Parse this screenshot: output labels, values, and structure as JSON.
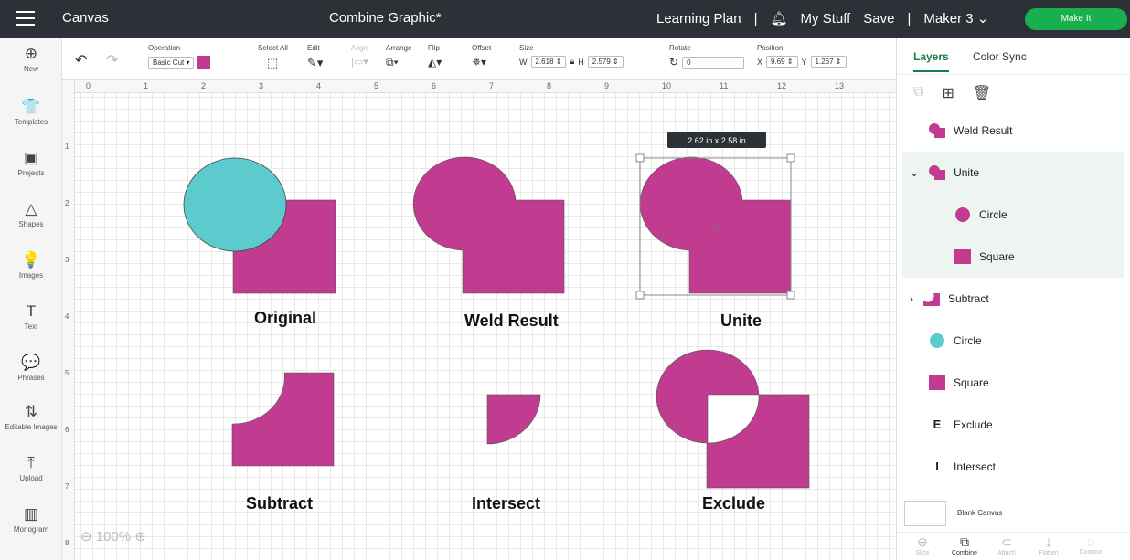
{
  "topbar": {
    "app_name": "Canvas",
    "doc_title": "Combine Graphic*",
    "learning_plan": "Learning Plan",
    "sep": "|",
    "my_stuff": "My Stuff",
    "save": "Save",
    "machine": "Maker 3",
    "make_it": "Make It"
  },
  "sidebar": {
    "items": [
      {
        "label": "New",
        "icon": "⊕"
      },
      {
        "label": "Templates",
        "icon": "👕"
      },
      {
        "label": "Projects",
        "icon": "▣"
      },
      {
        "label": "Shapes",
        "icon": "△"
      },
      {
        "label": "Images",
        "icon": "💡"
      },
      {
        "label": "Text",
        "icon": "T"
      },
      {
        "label": "Phrases",
        "icon": "💬"
      },
      {
        "label": "Editable Images",
        "icon": "⇅"
      },
      {
        "label": "Upload",
        "icon": "⤒"
      },
      {
        "label": "Monogram",
        "icon": "▥"
      }
    ]
  },
  "toolbar": {
    "operation_label": "Operation",
    "operation_value": "Basic Cut",
    "select_all": "Select All",
    "edit": "Edit",
    "align": "Align",
    "arrange": "Arrange",
    "flip": "Flip",
    "offset": "Offset",
    "size": "Size",
    "w_label": "W",
    "w_value": "2.618",
    "h_label": "H",
    "h_value": "2.579",
    "rotate": "Rotate",
    "rotate_value": "0",
    "position": "Position",
    "x_label": "X",
    "x_value": "9.69",
    "y_label": "Y",
    "y_value": "1.267"
  },
  "ruler": {
    "h": [
      "0",
      "1",
      "2",
      "3",
      "4",
      "5",
      "6",
      "7",
      "8",
      "9",
      "10",
      "11",
      "12",
      "13"
    ],
    "v": [
      "1",
      "2",
      "3",
      "4",
      "5",
      "6",
      "7",
      "8"
    ]
  },
  "canvas": {
    "size_tooltip": "2.62  in x 2.58  in",
    "labels": {
      "original": "Original",
      "weld": "Weld Result",
      "unite": "Unite",
      "subtract": "Subtract",
      "intersect": "Intersect",
      "exclude": "Exclude"
    },
    "zoom": "100%",
    "colors": {
      "magenta": "#c13b91",
      "teal": "#5ccbce"
    }
  },
  "panel": {
    "tab_layers": "Layers",
    "tab_color_sync": "Color Sync",
    "layers": [
      {
        "label": "Weld Result",
        "prefix": ""
      },
      {
        "label": "Unite",
        "prefix": "⌄"
      },
      {
        "label": "Circle",
        "prefix": ""
      },
      {
        "label": "Square",
        "prefix": ""
      },
      {
        "label": "Subtract",
        "prefix": "›"
      },
      {
        "label": "Circle",
        "prefix": ""
      },
      {
        "label": "Square",
        "prefix": ""
      },
      {
        "label": "Exclude",
        "prefix": "",
        "glyph": "E"
      },
      {
        "label": "Intersect",
        "prefix": "",
        "glyph": "I"
      }
    ],
    "blank_canvas": "Blank Canvas",
    "bottom": [
      "Slice",
      "Combine",
      "Attach",
      "Flatten",
      "Contour"
    ]
  }
}
